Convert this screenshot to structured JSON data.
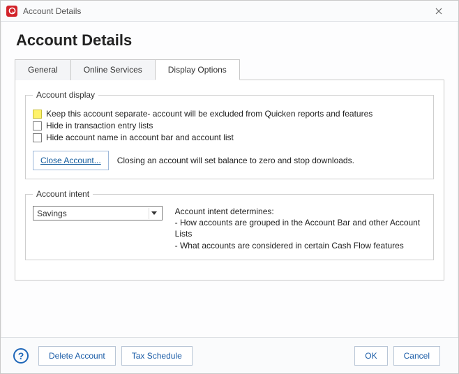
{
  "window": {
    "title": "Account Details"
  },
  "page": {
    "heading": "Account Details"
  },
  "tabs": {
    "general": "General",
    "online": "Online Services",
    "display": "Display Options"
  },
  "accountDisplay": {
    "legend": "Account display",
    "keepSeparate": "Keep this account separate- account will be excluded from Quicken reports and features",
    "hideTxn": "Hide in transaction entry lists",
    "hideName": "Hide account name in account bar and account list",
    "closeBtn": "Close Account...",
    "closeDesc": "Closing an account will set balance to zero and stop downloads."
  },
  "accountIntent": {
    "legend": "Account intent",
    "selected": "Savings",
    "descLead": "Account intent determines:",
    "desc1": "- How accounts are grouped in the Account Bar and other Account Lists",
    "desc2": "- What accounts are considered in certain Cash Flow features"
  },
  "footer": {
    "help": "?",
    "delete": "Delete Account",
    "tax": "Tax Schedule",
    "ok": "OK",
    "cancel": "Cancel"
  }
}
